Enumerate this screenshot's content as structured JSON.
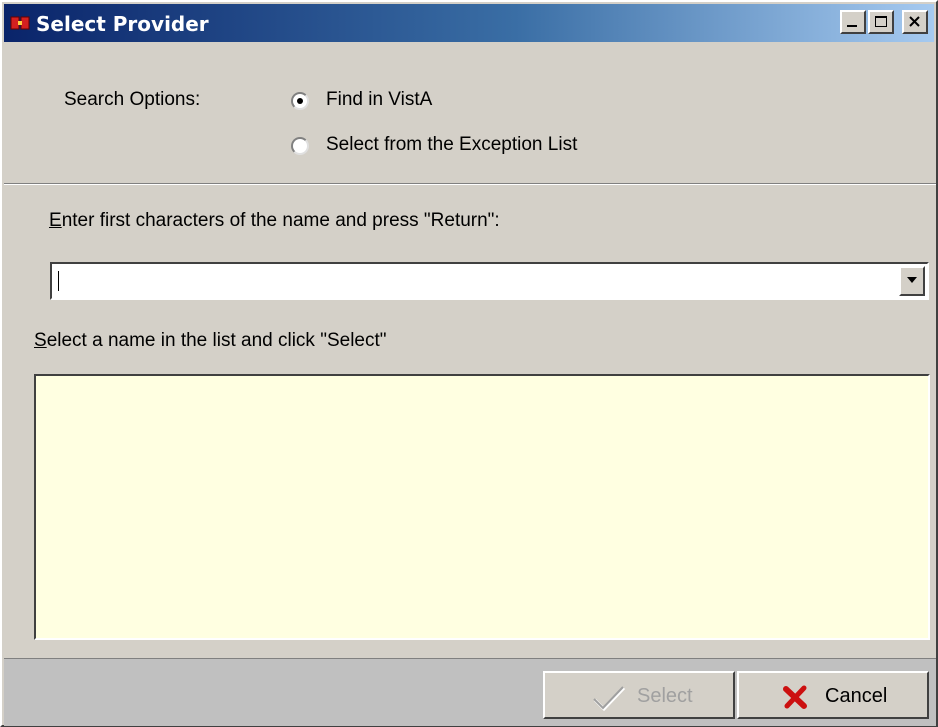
{
  "window": {
    "title": "Select Provider",
    "controls": [
      "minimize",
      "maximize",
      "close"
    ]
  },
  "search_options": {
    "label": "Search Options:",
    "options": [
      {
        "label": "Find in  VistA",
        "selected": true
      },
      {
        "label": "Select from the Exception  List",
        "selected": false
      }
    ]
  },
  "name_entry": {
    "label_accel": "E",
    "label_rest": "nter first characters of the name and press \"Return\":",
    "value": ""
  },
  "name_list": {
    "label_accel": "S",
    "label_rest": "elect a name in the list and click \"Select\"",
    "items": []
  },
  "buttons": {
    "select_label": "Select",
    "select_enabled": false,
    "cancel_label": "Cancel"
  },
  "colors": {
    "titlebar_start": "#0a246a",
    "titlebar_end": "#a6caf0",
    "dialog_face": "#d4d0c8",
    "list_background": "#ffffe1",
    "cancel_icon": "#cc1010"
  }
}
